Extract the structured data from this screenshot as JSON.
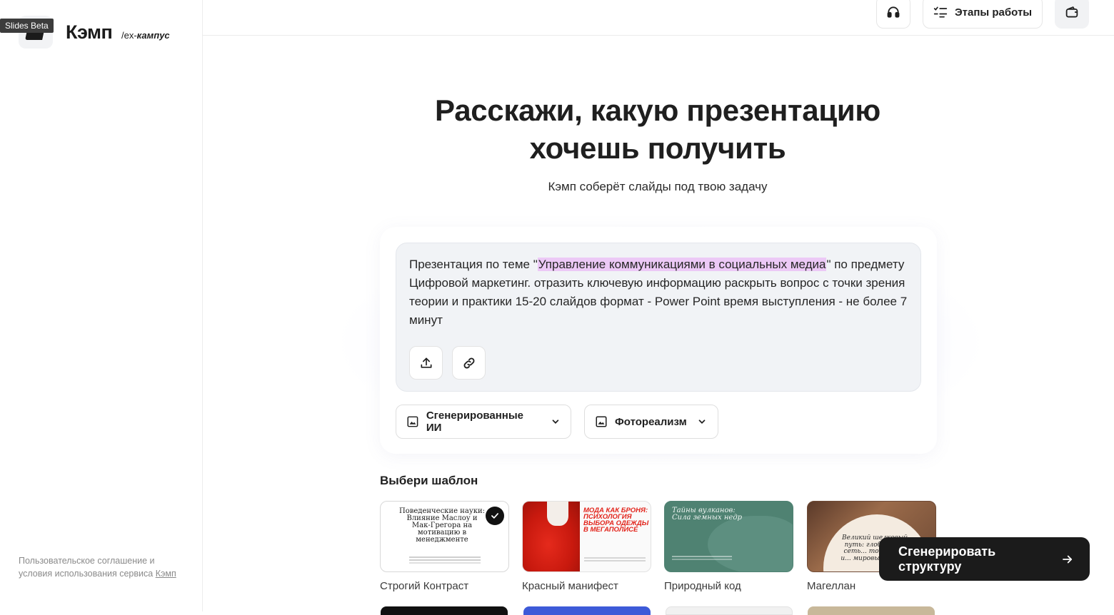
{
  "sidebar": {
    "beta_tag": "Slides Beta",
    "brand_name": "Кэмп",
    "brand_sub_prefix": "/ex-",
    "brand_sub_name": "кампус",
    "legal_text": "Пользовательское соглашение и условия использования сервиса",
    "legal_link": "Кэмп"
  },
  "topbar": {
    "support_icon": "headphones-icon",
    "stages_label": "Этапы работы",
    "stages_icon": "checklist-icon",
    "wallet_icon": "wallet-icon"
  },
  "hero": {
    "title_line1": "Расскажи, какую презентацию",
    "title_line2": "хочешь получить",
    "subtitle": "Кэмп соберёт слайды под твою задачу"
  },
  "prompt": {
    "text_before": "Презентация по теме \"",
    "text_highlight": "Управление коммуникациями в социальных медиа",
    "text_after": "\" по предмету Цифровой маркетинг. отразить ключевую информацию раскрыть вопрос с точки зрения теории и практики 15-20 слайдов формат - Power Point время выступления - не более 7 минут",
    "highlight_color": "#ecc9f6"
  },
  "options": {
    "images_label": "Сгенерированные ИИ",
    "style_label": "Фотореализм"
  },
  "templates": {
    "title": "Выбери шаблон",
    "items": [
      {
        "name": "Строгий Контраст",
        "preview_title": "Поведенческие науки: Влияние Маслоу и Мак-Грегора на мотивацию в менеджменте",
        "selected": true
      },
      {
        "name": "Красный манифест",
        "preview_title": "МОДА КАК БРОНЯ: ПСИХОЛОГИЯ ВЫБОРА ОДЕЖДЫ В МЕГАПОЛИСЕ",
        "selected": false
      },
      {
        "name": "Природный код",
        "preview_title": "Тайны вулканов: Сила земных недр",
        "selected": false
      },
      {
        "name": "Магеллан",
        "preview_title": "Великий шелковый путь: глобальная сеть... товарами, и... мировыми кул...",
        "selected": false
      }
    ]
  },
  "cta": {
    "label": "Сгенерировать структуру"
  },
  "colors": {
    "accent_dark": "#1b1b1b",
    "red_template": "#e2231a",
    "green_template": "#4f8272"
  }
}
